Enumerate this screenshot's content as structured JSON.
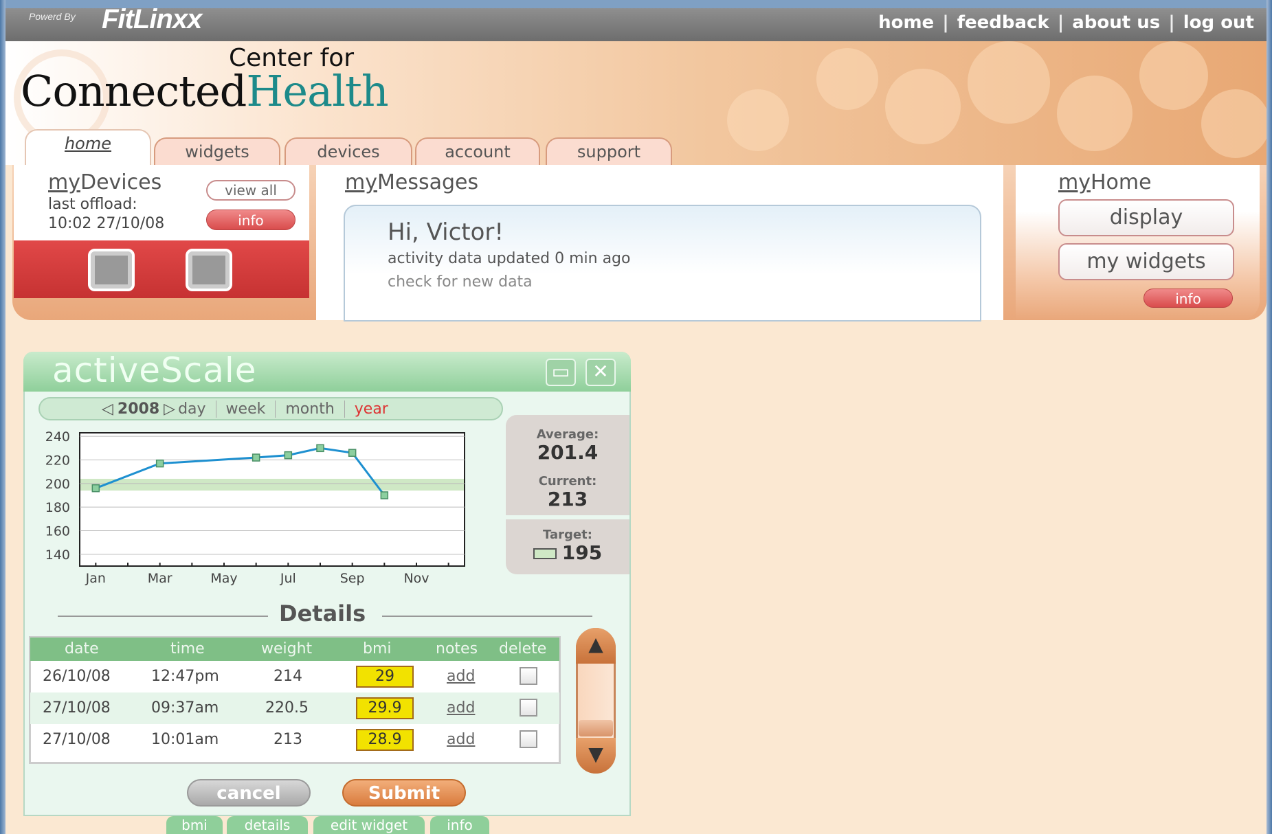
{
  "topbar": {
    "powered_by": "Powerd By",
    "brand": "FitLinxx",
    "links": [
      "home",
      "feedback",
      "about us",
      "log out"
    ],
    "separator": "|"
  },
  "header": {
    "center_for": "Center for",
    "connected": "Connected",
    "health": "Health"
  },
  "tabs": [
    "home",
    "widgets",
    "devices",
    "account",
    "support"
  ],
  "devices": {
    "title_prefix": "my",
    "title": "Devices",
    "last_offload_label": "last offload:",
    "last_offload_value": "10:02 27/10/08",
    "view_all": "view all",
    "info": "info"
  },
  "messages": {
    "title_prefix": "my",
    "title": "Messages",
    "greeting": "Hi, Victor!",
    "activity": "activity data updated 0 min ago",
    "check": "check for new data"
  },
  "home_panel": {
    "title_prefix": "my",
    "title": "Home",
    "display": "display",
    "my_widgets": "my widgets",
    "info": "info"
  },
  "widget": {
    "title": "activeScale",
    "year": "2008",
    "periods": [
      "day",
      "week",
      "month",
      "year"
    ],
    "selected_period": "year",
    "average_label": "Average:",
    "average_value": "201.4",
    "current_label": "Current:",
    "current_value": "213",
    "target_label": "Target:",
    "target_value": "195",
    "details_title": "Details",
    "columns": [
      "date",
      "time",
      "weight",
      "bmi",
      "notes",
      "delete"
    ],
    "rows": [
      {
        "date": "26/10/08",
        "time": "12:47pm",
        "weight": "214",
        "bmi": "29",
        "notes": "add"
      },
      {
        "date": "27/10/08",
        "time": "09:37am",
        "weight": "220.5",
        "bmi": "29.9",
        "notes": "add"
      },
      {
        "date": "27/10/08",
        "time": "10:01am",
        "weight": "213",
        "bmi": "28.9",
        "notes": "add"
      }
    ],
    "cancel": "cancel",
    "submit": "Submit",
    "bottom_tabs": [
      "bmi",
      "details",
      "edit widget",
      "info"
    ]
  },
  "chart_data": {
    "type": "line",
    "title": "",
    "xlabel": "",
    "ylabel": "",
    "x_ticks": [
      "Jan",
      "Mar",
      "May",
      "Jul",
      "Sep",
      "Nov"
    ],
    "y_ticks": [
      240,
      220,
      200,
      180,
      160,
      140
    ],
    "ylim": [
      130,
      243
    ],
    "xlim": [
      0.5,
      12.5
    ],
    "target_band": [
      194,
      204
    ],
    "series": [
      {
        "x": [
          1,
          3,
          6,
          7,
          8,
          9,
          10
        ],
        "y": [
          196,
          217,
          222,
          224,
          230,
          226,
          190
        ]
      }
    ],
    "grid": true
  },
  "colors": {
    "line": "#1e90d0",
    "marker": "#8ccf9f",
    "band": "#cfe8c5",
    "accent_red": "#d94c4c",
    "widget_green": "#8fcf9a"
  }
}
